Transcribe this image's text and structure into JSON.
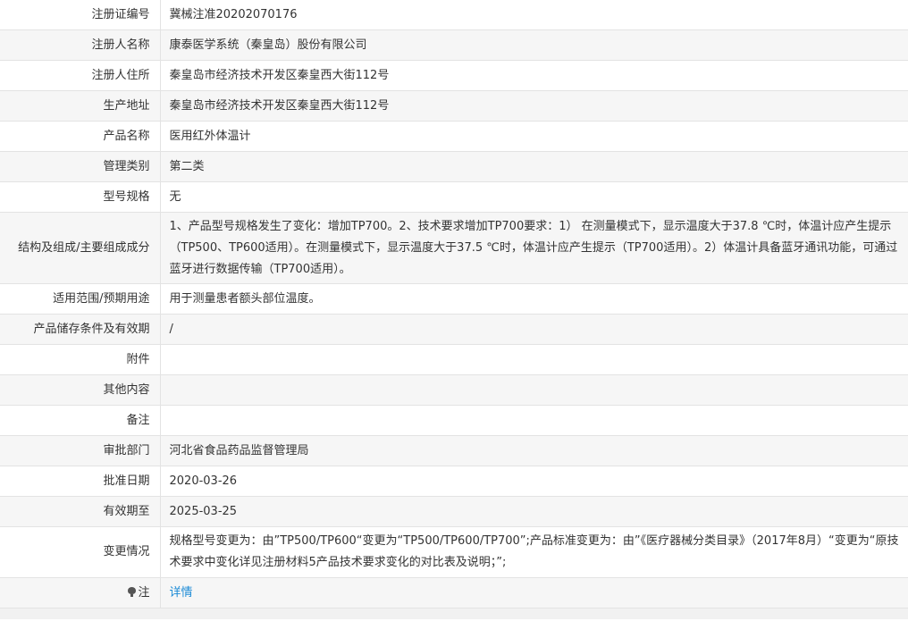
{
  "rows": [
    {
      "label": "注册证编号",
      "value": "冀械注准20202070176"
    },
    {
      "label": "注册人名称",
      "value": "康泰医学系统（秦皇岛）股份有限公司"
    },
    {
      "label": "注册人住所",
      "value": "秦皇岛市经济技术开发区秦皇西大街112号"
    },
    {
      "label": "生产地址",
      "value": "秦皇岛市经济技术开发区秦皇西大街112号"
    },
    {
      "label": "产品名称",
      "value": "医用红外体温计"
    },
    {
      "label": "管理类别",
      "value": "第二类"
    },
    {
      "label": "型号规格",
      "value": "无"
    },
    {
      "label": "结构及组成/主要组成成分",
      "value": "1、产品型号规格发生了变化：增加TP700。2、技术要求增加TP700要求：1） 在测量模式下，显示温度大于37.8 ℃时，体温计应产生提示（TP500、TP600适用）。在测量模式下，显示温度大于37.5 ℃时，体温计应产生提示（TP700适用）。2）体温计具备蓝牙通讯功能，可通过蓝牙进行数据传输（TP700适用）。"
    },
    {
      "label": "适用范围/预期用途",
      "value": "用于测量患者额头部位温度。"
    },
    {
      "label": "产品储存条件及有效期",
      "value": "/"
    },
    {
      "label": "附件",
      "value": ""
    },
    {
      "label": "其他内容",
      "value": ""
    },
    {
      "label": "备注",
      "value": ""
    },
    {
      "label": "审批部门",
      "value": "河北省食品药品监督管理局"
    },
    {
      "label": "批准日期",
      "value": "2020-03-26"
    },
    {
      "label": "有效期至",
      "value": "2025-03-25"
    },
    {
      "label": "变更情况",
      "value": "规格型号变更为：由”TP500/TP600“变更为“TP500/TP600/TP700”;产品标准变更为：由”《医疗器械分类目录》（2017年8月）“变更为“原技术要求中变化详见注册材料5产品技术要求变化的对比表及说明；”;"
    }
  ],
  "note": {
    "label": "注",
    "icon": "lightbulb-icon",
    "link": "详情"
  }
}
